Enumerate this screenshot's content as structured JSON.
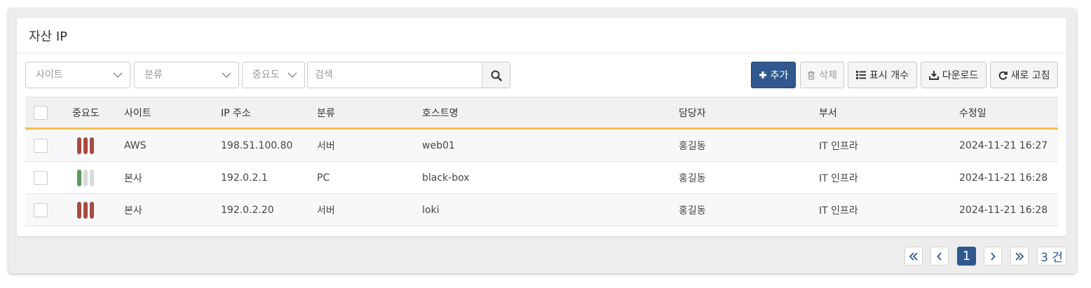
{
  "panel": {
    "title": "자산 IP"
  },
  "filters": {
    "site_placeholder": "사이트",
    "category_placeholder": "분류",
    "importance_placeholder": "중요도",
    "search_placeholder": "검색"
  },
  "toolbar": {
    "add_label": "추가",
    "delete_label": "삭제",
    "page_size_label": "표시 개수",
    "download_label": "다운로드",
    "refresh_label": "새로 고침"
  },
  "table": {
    "headers": {
      "importance": "중요도",
      "site": "사이트",
      "ip": "IP 주소",
      "category": "분류",
      "hostname": "호스트명",
      "owner": "담당자",
      "department": "부서",
      "modified": "수정일"
    },
    "rows": [
      {
        "importance_level": 3,
        "importance_color": "#a64b43",
        "site": "AWS",
        "ip": "198.51.100.80",
        "category": "서버",
        "hostname": "web01",
        "owner": "홍길동",
        "department": "IT 인프라",
        "modified": "2024-11-21 16:27"
      },
      {
        "importance_level": 1,
        "importance_color": "#5a9a5a",
        "site": "본사",
        "ip": "192.0.2.1",
        "category": "PC",
        "hostname": "black-box",
        "owner": "홍길동",
        "department": "IT 인프라",
        "modified": "2024-11-21 16:28"
      },
      {
        "importance_level": 3,
        "importance_color": "#a64b43",
        "site": "본사",
        "ip": "192.0.2.20",
        "category": "서버",
        "hostname": "loki",
        "owner": "홍길동",
        "department": "IT 인프라",
        "modified": "2024-11-21 16:28"
      }
    ]
  },
  "pagination": {
    "current_page": "1",
    "total_label": "3 건"
  },
  "colors": {
    "primary": "#30588f",
    "header_accent": "#f0c252",
    "importance_empty": "#dadada"
  }
}
